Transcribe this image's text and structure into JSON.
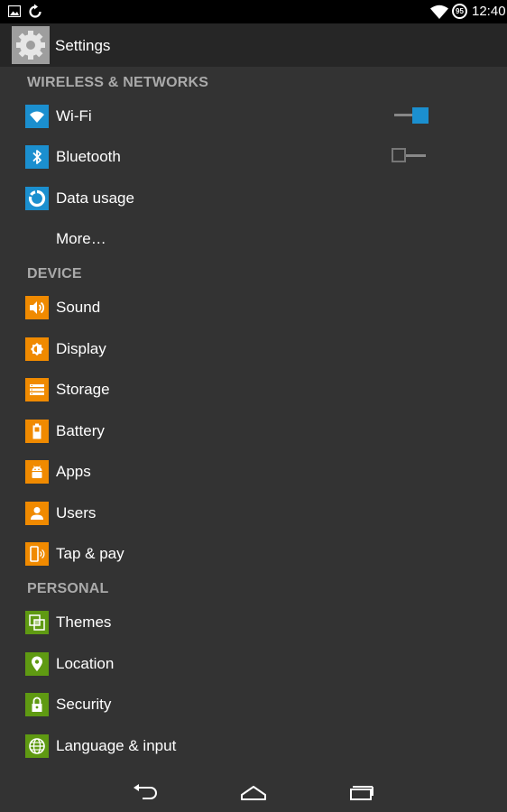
{
  "status_bar": {
    "time": "12:40",
    "battery_level": "95",
    "left_icons": [
      "image-notification-icon",
      "sync-notification-icon"
    ],
    "right_icons": [
      "wifi-signal-icon",
      "battery-icon"
    ]
  },
  "action_bar": {
    "title": "Settings",
    "icon": "settings-gear-icon"
  },
  "sections": {
    "wireless": "WIRELESS & NETWORKS",
    "device": "DEVICE",
    "personal": "PERSONAL"
  },
  "items": {
    "wifi": {
      "label": "Wi-Fi",
      "icon": "wifi-icon",
      "toggle": "on"
    },
    "bluetooth": {
      "label": "Bluetooth",
      "icon": "bluetooth-icon",
      "toggle": "off"
    },
    "data_usage": {
      "label": "Data usage",
      "icon": "data-usage-icon"
    },
    "more": {
      "label": "More…"
    },
    "sound": {
      "label": "Sound",
      "icon": "sound-icon"
    },
    "display": {
      "label": "Display",
      "icon": "display-icon"
    },
    "storage": {
      "label": "Storage",
      "icon": "storage-icon"
    },
    "battery": {
      "label": "Battery",
      "icon": "battery-icon"
    },
    "apps": {
      "label": "Apps",
      "icon": "android-apps-icon"
    },
    "users": {
      "label": "Users",
      "icon": "user-icon"
    },
    "tap_pay": {
      "label": "Tap & pay",
      "icon": "tap-and-pay-icon"
    },
    "themes": {
      "label": "Themes",
      "icon": "themes-icon"
    },
    "location": {
      "label": "Location",
      "icon": "location-pin-icon"
    },
    "security": {
      "label": "Security",
      "icon": "lock-icon"
    },
    "language": {
      "label": "Language & input",
      "icon": "globe-icon"
    }
  },
  "nav_bar": {
    "back": "back-icon",
    "home": "home-icon",
    "recents": "recent-apps-icon"
  },
  "colors": {
    "background": "#333333",
    "action_bar": "#262626",
    "status_bar": "#000000",
    "section_header": "#aaaaaa",
    "wireless_icon": "#1b8fcf",
    "device_icon": "#f08a00",
    "personal_icon": "#5f9a12",
    "toggle_on": "#1b8fcf"
  }
}
